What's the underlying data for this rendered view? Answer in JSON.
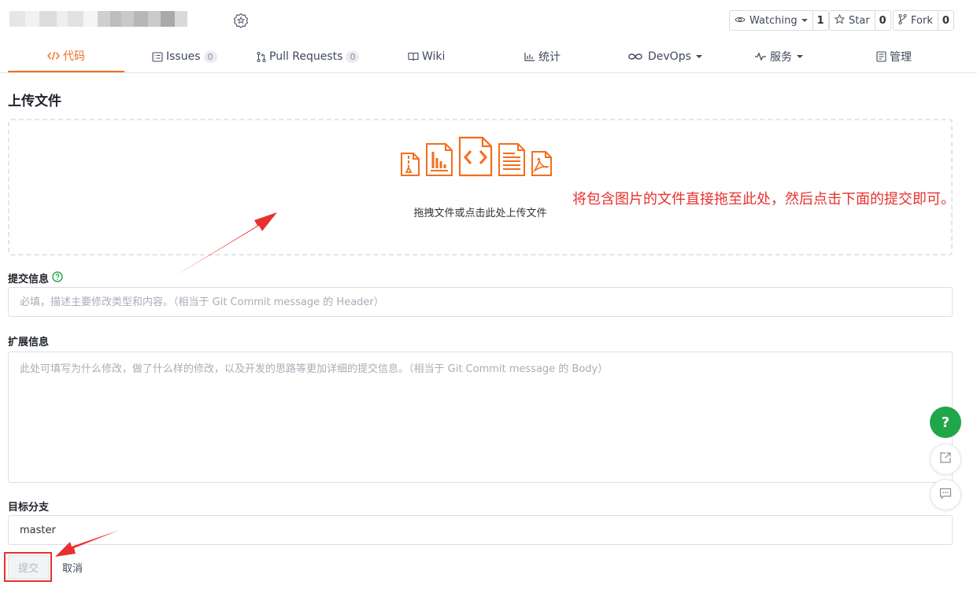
{
  "repo": {
    "name_blurred": true
  },
  "social": {
    "watching_label": "Watching",
    "watching_count": "1",
    "star_label": "Star",
    "star_count": "0",
    "fork_label": "Fork",
    "fork_count": "0"
  },
  "tabs": [
    {
      "label": "代码",
      "icon": "code-icon",
      "active": true
    },
    {
      "label": "Issues",
      "icon": "issues-icon",
      "count": "0"
    },
    {
      "label": "Pull Requests",
      "icon": "pull-request-icon",
      "count": "0"
    },
    {
      "label": "Wiki",
      "icon": "wiki-icon"
    },
    {
      "label": "统计",
      "icon": "chart-icon"
    },
    {
      "label": "DevOps",
      "icon": "infinity-icon",
      "dropdown": true
    },
    {
      "label": "服务",
      "icon": "pulse-icon",
      "dropdown": true
    },
    {
      "label": "管理",
      "icon": "manage-icon"
    }
  ],
  "page": {
    "title": "上传文件"
  },
  "dropzone": {
    "text": "拖拽文件或点击此处上传文件",
    "file_icons": [
      "zip-file-icon",
      "chart-file-icon",
      "code-file-icon",
      "text-file-icon",
      "pdf-file-icon"
    ]
  },
  "annotation": {
    "text": "将包含图片的文件直接拖至此处，然后点击下面的提交即可。"
  },
  "form": {
    "commit_label": "提交信息",
    "commit_placeholder": "必填，描述主要修改类型和内容。（相当于 Git Commit message 的 Header）",
    "extended_label": "扩展信息",
    "extended_placeholder": "此处可填写为什么修改，做了什么样的修改，以及开发的思路等更加详细的提交信息。（相当于 Git Commit message 的 Body）",
    "branch_label": "目标分支",
    "branch_value": "master",
    "submit_label": "提交",
    "cancel_label": "取消"
  },
  "float": {
    "help_label": "?"
  },
  "colors": {
    "accent": "#f26e1e",
    "annotation": "#e8302e",
    "help_green": "#21a64a"
  }
}
